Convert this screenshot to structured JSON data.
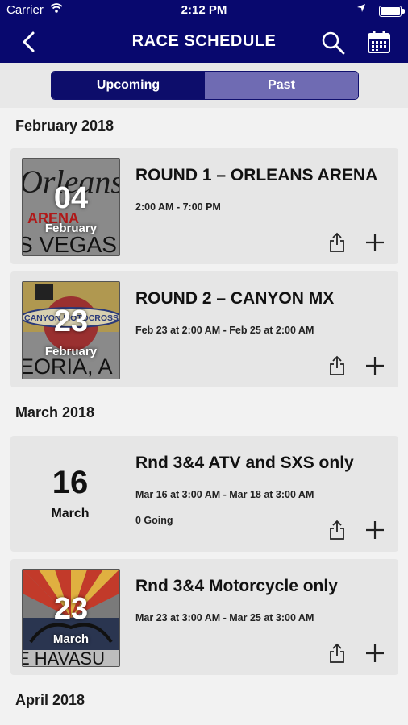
{
  "status_bar": {
    "carrier": "Carrier",
    "time": "2:12 PM"
  },
  "nav": {
    "title": "RACE SCHEDULE"
  },
  "tabs": {
    "upcoming": "Upcoming",
    "past": "Past"
  },
  "sections": [
    {
      "label": "February 2018"
    },
    {
      "label": "March 2018"
    },
    {
      "label": "April 2018"
    }
  ],
  "events": [
    {
      "day": "04",
      "month": "February",
      "title": "ROUND 1 – ORLEANS ARENA",
      "times": "2:00 AM - 7:00 PM",
      "going": ""
    },
    {
      "day": "23",
      "month": "February",
      "title": "ROUND 2 – CANYON MX",
      "times": "Feb 23 at 2:00 AM - Feb 25 at 2:00 AM",
      "going": ""
    },
    {
      "day": "16",
      "month": "March",
      "title": "Rnd 3&4 ATV and SXS only",
      "times": "Mar 16 at 3:00 AM - Mar 18 at 3:00 AM",
      "going": "0 Going"
    },
    {
      "day": "23",
      "month": "March",
      "title": "Rnd 3&4 Motorcycle only",
      "times": "Mar 23 at 3:00 AM - Mar 25 at 3:00 AM",
      "going": ""
    }
  ],
  "thumb_texts": {
    "orleans": {
      "top": "Orleans",
      "mid": "ARENA",
      "bottom": "S VEGAS,"
    },
    "canyon": {
      "top": "CANYON MOTOCROSS",
      "bottom": "EORIA, A"
    },
    "havasu": {
      "bottom": "E HAVASU"
    }
  },
  "colors": {
    "nav_bg": "#08086e",
    "tab_active": "#0d0d6b",
    "tab_inactive": "#6f6bb3",
    "card_bg": "#e6e6e6"
  }
}
